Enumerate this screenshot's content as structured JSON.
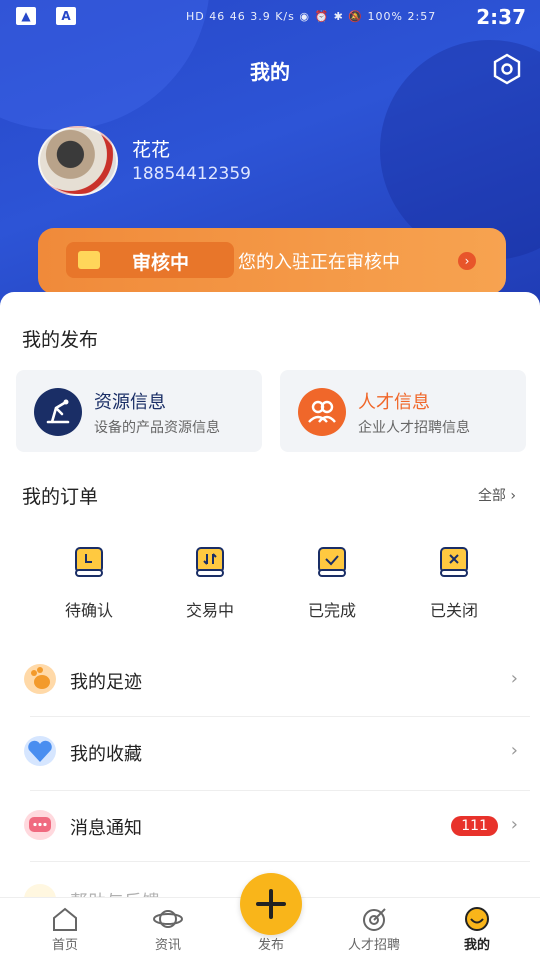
{
  "status_bar": {
    "time": "2:37",
    "icons": "HD 46 46 3.9 K/s ◉ ⏰ ✱ 🔕 100% 2:57"
  },
  "header": {
    "title": "我的"
  },
  "user": {
    "name": "花花",
    "phone": "18854412359"
  },
  "audit": {
    "tag": "审核中",
    "message": "您的入驻正在审核中"
  },
  "publish": {
    "title": "我的发布",
    "items": [
      {
        "title": "资源信息",
        "subtitle": "设备的产品资源信息",
        "icon": "crane-icon",
        "color": "#1a2e66"
      },
      {
        "title": "人才信息",
        "subtitle": "企业人才招聘信息",
        "icon": "people-icon",
        "color": "#f0672a"
      }
    ]
  },
  "orders": {
    "title": "我的订单",
    "all": "全部",
    "items": [
      {
        "label": "待确认",
        "icon": "clock-icon"
      },
      {
        "label": "交易中",
        "icon": "exchange-icon"
      },
      {
        "label": "已完成",
        "icon": "check-icon"
      },
      {
        "label": "已关闭",
        "icon": "close-icon"
      }
    ]
  },
  "menu": [
    {
      "label": "我的足迹",
      "icon": "footprint-icon"
    },
    {
      "label": "我的收藏",
      "icon": "heart-icon"
    },
    {
      "label": "消息通知",
      "icon": "message-icon",
      "badge": "111"
    },
    {
      "label": "帮助与反馈",
      "icon": "help-icon"
    }
  ],
  "tabs": [
    {
      "label": "首页",
      "icon": "home-icon"
    },
    {
      "label": "资讯",
      "icon": "planet-icon"
    },
    {
      "label": "发布",
      "icon": "plus-icon"
    },
    {
      "label": "人才招聘",
      "icon": "target-icon"
    },
    {
      "label": "我的",
      "icon": "smile-icon"
    }
  ],
  "colors": {
    "accent": "#f9b51a",
    "brand": "#2748c9",
    "orange": "#f0672a",
    "badge": "#e8322b"
  }
}
